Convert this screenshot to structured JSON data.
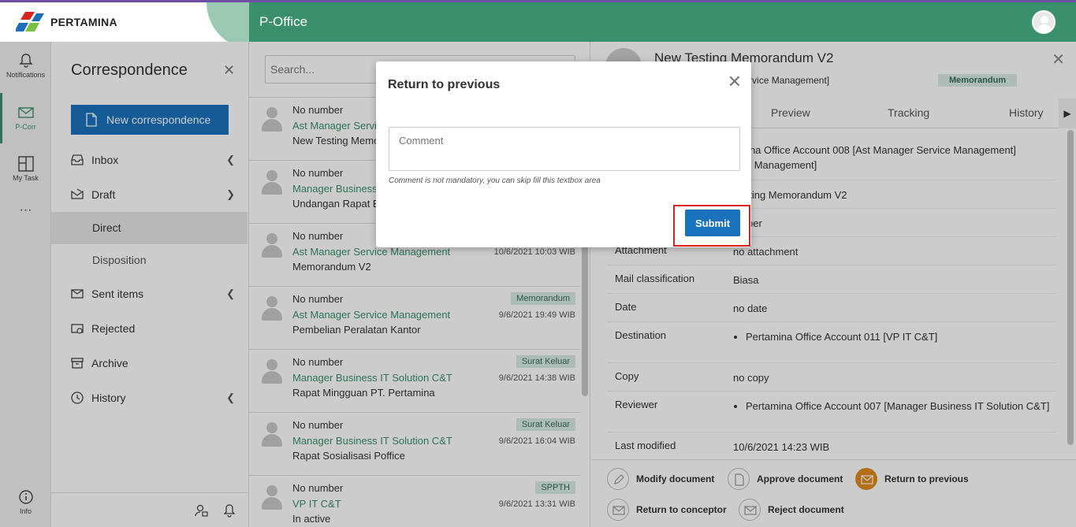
{
  "brand": {
    "name": "PERTAMINA",
    "app_title": "P-Office"
  },
  "rail": {
    "notifications": "Notifications",
    "pcorr": "P-Corr",
    "mytask": "My Task",
    "more": "···",
    "info": "Info"
  },
  "sidebar": {
    "title": "Correspondence",
    "new_button": "New correspondence",
    "items": [
      {
        "label": "Inbox"
      },
      {
        "label": "Draft"
      },
      {
        "label": "Direct"
      },
      {
        "label": "Disposition"
      },
      {
        "label": "Sent items"
      },
      {
        "label": "Rejected"
      },
      {
        "label": "Archive"
      },
      {
        "label": "History"
      }
    ]
  },
  "list": {
    "search_placeholder": "Search...",
    "items": [
      {
        "number": "No number",
        "sender": "Ast Manager Servic",
        "subject": "New Testing Memor",
        "tag": "",
        "date": ""
      },
      {
        "number": "No number",
        "sender": "Manager Business",
        "subject": "Undangan Rapat Ev",
        "tag": "",
        "date": ""
      },
      {
        "number": "No number",
        "sender": "Ast Manager Service Management",
        "subject": "Memorandum V2",
        "tag": "",
        "date": "10/6/2021 10:03 WIB"
      },
      {
        "number": "No number",
        "sender": "Ast Manager Service Management",
        "subject": "Pembelian Peralatan Kantor",
        "tag": "Memorandum",
        "date": "9/6/2021 19:49 WIB"
      },
      {
        "number": "No number",
        "sender": "Manager Business IT Solution C&T",
        "subject": "Rapat Mingguan PT. Pertamina",
        "tag": "Surat Keluar",
        "date": "9/6/2021 14:38 WIB"
      },
      {
        "number": "No number",
        "sender": "Manager Business IT Solution C&T",
        "subject": "Rapat Sosialisasi Poffice",
        "tag": "Surat Keluar",
        "date": "9/6/2021 16:04 WIB"
      },
      {
        "number": "No number",
        "sender": "VP IT C&T",
        "subject": "In active",
        "tag": "SPPTH",
        "date": "9/6/2021 13:31 WIB"
      }
    ]
  },
  "detail": {
    "title": "New Testing Memorandum V2",
    "subtitle": "rvice Management [Service Management]",
    "tag": "Memorandum",
    "tabs": [
      "Preview",
      "Tracking",
      "History"
    ],
    "rows": [
      {
        "key": "",
        "value": "amina Office Account 008 [Ast Manager Service Management]\nvice Management]"
      },
      {
        "key": "",
        "value": "Testing Memorandum V2"
      },
      {
        "key": "",
        "value": "umber"
      },
      {
        "key": "Attachment",
        "value": "no attachment"
      },
      {
        "key": "Mail classification",
        "value": "Biasa"
      },
      {
        "key": "Date",
        "value": "no date"
      },
      {
        "key": "Destination",
        "value": "Pertamina Office Account 011 [VP IT C&T]"
      },
      {
        "key": "Copy",
        "value": "no copy"
      },
      {
        "key": "Reviewer",
        "value": "Pertamina Office Account 007 [Manager Business IT Solution C&T]"
      },
      {
        "key": "Last modified",
        "value": "10/6/2021 14:23 WIB"
      }
    ],
    "actions": {
      "modify": "Modify document",
      "approve": "Approve document",
      "return_prev": "Return to previous",
      "return_conceptor": "Return to conceptor",
      "reject": "Reject document"
    }
  },
  "modal": {
    "title": "Return to previous",
    "comment_placeholder": "Comment",
    "hint": "Comment is not mandatory, you can skip fill this textbox area",
    "submit": "Submit"
  },
  "colors": {
    "header": "#3a8f6c",
    "primary": "#1a72bd",
    "highlight": "#e02020",
    "accent": "#e08a1e"
  }
}
